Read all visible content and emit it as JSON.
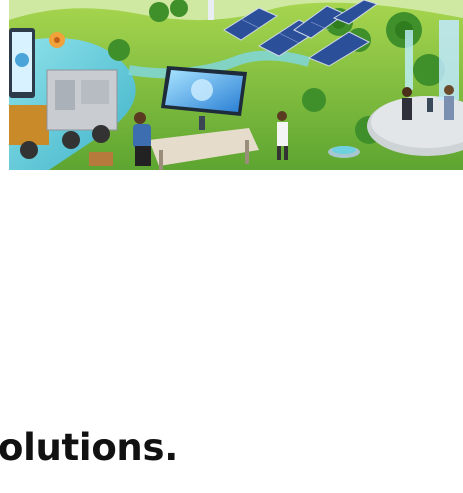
{
  "hero": {
    "icon": "illustration-icon"
  },
  "headline": {
    "text": "olutions."
  },
  "colors": {
    "text": "#111111",
    "background": "#ffffff",
    "grass": "#7cc23f",
    "water": "#6fd0df",
    "solar_panel": "#2c4f9a"
  }
}
